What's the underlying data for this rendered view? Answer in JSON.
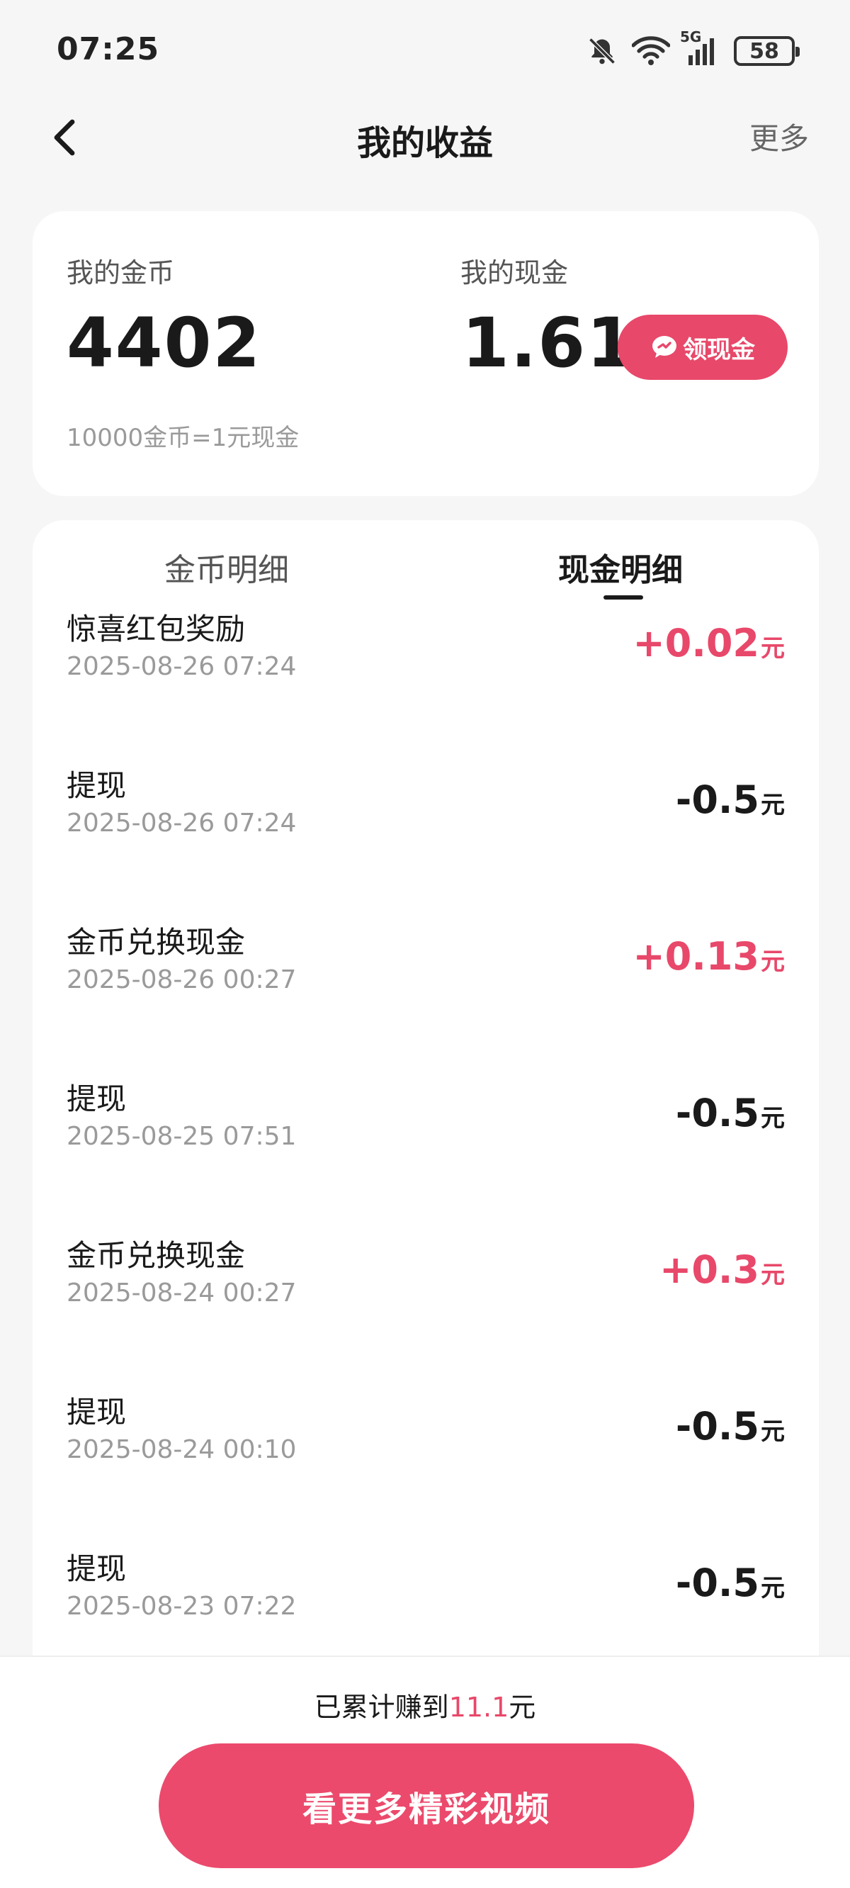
{
  "status_bar": {
    "time": "07:25",
    "battery": "58",
    "network": "5G",
    "icons": [
      "mute-bell-icon",
      "wifi-icon",
      "cellular-signal-icon",
      "battery-icon"
    ]
  },
  "nav": {
    "title": "我的收益",
    "more": "更多",
    "back_icon": "chevron-left-icon"
  },
  "summary": {
    "coins_label": "我的金币",
    "coins_value": "4402",
    "cash_label": "我的现金",
    "cash_value": "1.61",
    "claim_label": "领现金",
    "claim_icon": "wechat-icon",
    "exchange_note": "10000金币=1元现金"
  },
  "tabs": {
    "coins_detail": "金币明细",
    "cash_detail": "现金明细",
    "active": "cash_detail"
  },
  "transactions": [
    {
      "title": "惊喜红包奖励",
      "time": "2025-08-26 07:24",
      "amount": "+0.02",
      "unit": "元",
      "type": "income"
    },
    {
      "title": "提现",
      "time": "2025-08-26 07:24",
      "amount": "-0.5",
      "unit": "元",
      "type": "expense"
    },
    {
      "title": "金币兑换现金",
      "time": "2025-08-26 00:27",
      "amount": "+0.13",
      "unit": "元",
      "type": "income"
    },
    {
      "title": "提现",
      "time": "2025-08-25 07:51",
      "amount": "-0.5",
      "unit": "元",
      "type": "expense"
    },
    {
      "title": "金币兑换现金",
      "time": "2025-08-24 00:27",
      "amount": "+0.3",
      "unit": "元",
      "type": "income"
    },
    {
      "title": "提现",
      "time": "2025-08-24 00:10",
      "amount": "-0.5",
      "unit": "元",
      "type": "expense"
    },
    {
      "title": "提现",
      "time": "2025-08-23 07:22",
      "amount": "-0.5",
      "unit": "元",
      "type": "expense"
    }
  ],
  "footer": {
    "earned_prefix": "已累计赚到",
    "earned_amount": "11.1",
    "earned_suffix": "元",
    "watch_button": "看更多精彩视频"
  },
  "colors": {
    "accent": "#e8486a",
    "background": "#f6f6f6",
    "card": "#ffffff",
    "text_primary": "#1a1a1a",
    "text_secondary": "#9a9a9a"
  }
}
